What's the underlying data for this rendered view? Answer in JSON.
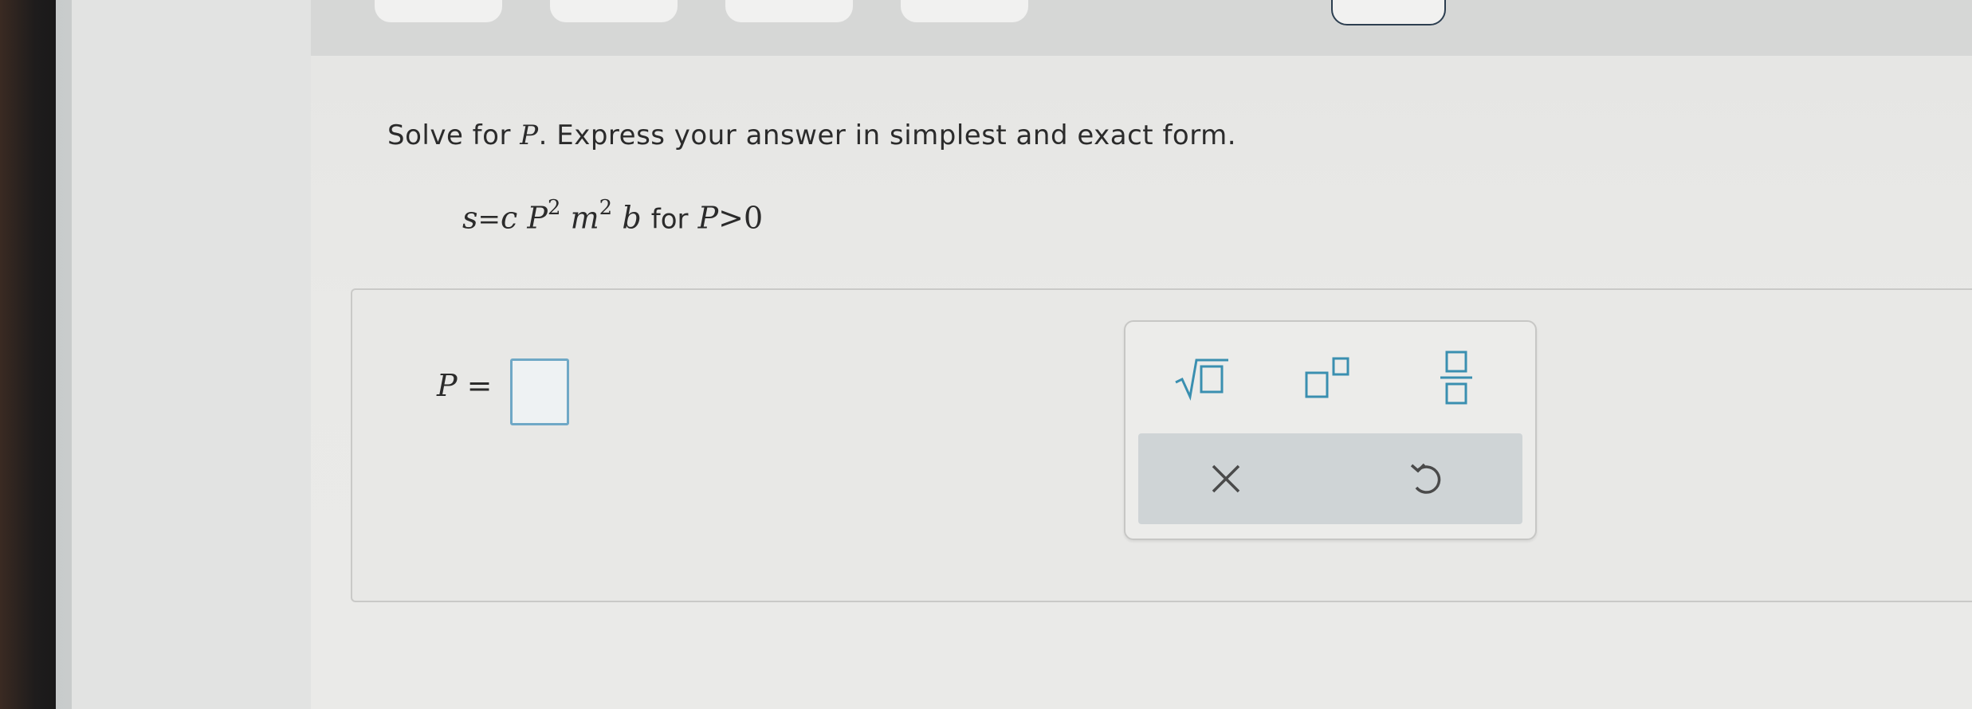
{
  "question": {
    "prefix": "Solve for ",
    "variable": "P",
    "suffix": ". Express your answer in simplest and exact form."
  },
  "equation": {
    "lhs": "s",
    "equals": "=",
    "c": "c",
    "P": "P",
    "P_exp": "2",
    "m": "m",
    "m_exp": "2",
    "b": "b",
    "for_text": "for",
    "cond_var": "P",
    "cond_op": ">",
    "cond_val": "0"
  },
  "answer": {
    "label": "P",
    "equals": "=",
    "value": ""
  },
  "toolbar": {
    "buttons": [
      {
        "name": "square-root-icon"
      },
      {
        "name": "exponent-icon"
      },
      {
        "name": "fraction-icon"
      }
    ],
    "clear_icon": "close-icon",
    "undo_icon": "undo-icon"
  },
  "colors": {
    "input_border": "#6fa8c6",
    "icon": "#3a8fb0",
    "icon_dark": "#4a4a4a"
  }
}
